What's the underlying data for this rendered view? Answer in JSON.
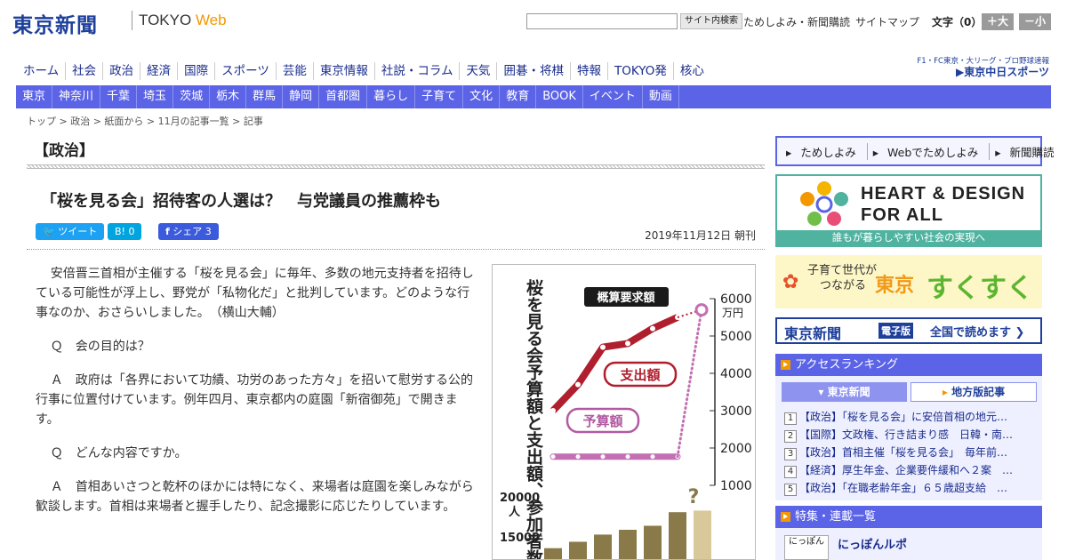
{
  "header": {
    "logo": "東京新聞",
    "logo_sub_a": "TOKYO ",
    "logo_sub_b": "Web",
    "search_button": "サイト内検索",
    "links": [
      "ためしよみ・新聞購読",
      "サイトマップ"
    ],
    "fontsize_label": "文字（0）",
    "font_up": "＋大",
    "font_down": "－小"
  },
  "nav_main": [
    "ホーム",
    "社会",
    "政治",
    "経済",
    "国際",
    "スポーツ",
    "芸能",
    "東京情報",
    "社説・コラム",
    "天気",
    "囲碁・将棋",
    "特報",
    "TOKYO発",
    "核心"
  ],
  "chunichi": {
    "line1": "F1・FC東京・大リーグ・プロ野球速報",
    "line2": "▶東京中日スポーツ"
  },
  "nav_region": [
    "東京",
    "神奈川",
    "千葉",
    "埼玉",
    "茨城",
    "栃木",
    "群馬",
    "静岡",
    "首都圏",
    "暮らし",
    "子育て",
    "文化",
    "教育",
    "BOOK",
    "イベント",
    "動画"
  ],
  "breadcrumb": "トップ > 政治 > 紙面から > 11月の記事一覧 > 記事",
  "section": "【政治】",
  "article": {
    "headline": "「桜を見る会」招待客の人選は？　与党議員の推薦枠も",
    "tweet": "ツイート",
    "hatena": "B! 0",
    "share": "シェア 3",
    "date": "2019年11月12日 朝刊",
    "paragraphs": [
      "安倍晋三首相が主催する「桜を見る会」に毎年、多数の地元支持者を招待している可能性が浮上し、野党が「私物化だ」と批判しています。どのような行事なのか、おさらいしました。　（横山大輔）",
      "Ｑ　会の目的は？",
      "Ａ　政府は「各界において功績、功労のあった方々」を招いて慰労する公的行事に位置付けています。例年四月、東京都内の庭園「新宿御苑」で開きます。",
      "Ｑ　どんな内容ですか。",
      "Ａ　首相あいさつと乾杯のほかには特になく、来場者は庭園を楽しみながら歓談します。首相は来場者と握手したり、記念撮影に応じたりしています。"
    ]
  },
  "figure": {
    "title": "桜を見る会予算額と支出額、参加者数",
    "label_request": "概算要求額",
    "label_spend": "支出額",
    "label_budget": "予算額",
    "y_ticks": [
      "6000",
      "5000",
      "4000",
      "3000",
      "2000",
      "1000"
    ],
    "y_unit": "万円",
    "count_ticks": [
      "20000",
      "15000"
    ],
    "count_unit": "人",
    "question": "?"
  },
  "chart_data": {
    "type": "line",
    "title": "桜を見る会予算額と支出額、参加者数",
    "ylabel": "万円",
    "ylim": [
      1000,
      6000
    ],
    "series": [
      {
        "name": "支出額",
        "values": [
          3000,
          3700,
          4700,
          4800,
          5200,
          5500
        ]
      },
      {
        "name": "予算額",
        "values": [
          1767,
          1767,
          1767,
          1767,
          1767,
          1767
        ]
      },
      {
        "name": "概算要求額",
        "values": [
          5700
        ]
      }
    ],
    "participants": {
      "unit": "人",
      "ticks": [
        20000,
        15000
      ],
      "values": [
        13700,
        14500,
        15400,
        16000,
        16500,
        18200,
        18400
      ]
    }
  },
  "sidebar": {
    "mini_links": [
      "ためしよみ",
      "Webでためしよみ",
      "新聞購読"
    ],
    "heart_title_1": "HEART & DESIGN",
    "heart_title_2": "FOR ALL",
    "heart_caption": "誰もが暮らしやすい社会の実現へ",
    "suku_a_1": "子育て世代が",
    "suku_a_2": "つながる",
    "suku_b": "東京",
    "suku_c": "すくすく",
    "epaper_logo": "東京新聞",
    "epaper_tag": "電子版",
    "epaper_text": "全国で読めます ❯",
    "ranking_title": "アクセスランキング",
    "ranking_tab1": "東京新聞",
    "ranking_tab2": "地方版記事",
    "ranking": [
      "【政治】「桜を見る会」に安倍首相の地元…",
      "【国際】文政権、行き詰まり感　日韓・南…",
      "【政治】首相主催「桜を見る会」　毎年前…",
      "【経済】厚生年金、企業要件緩和へ２案　…",
      "【政治】「在職老齢年金」６５歳超支給　…"
    ],
    "special_title": "特集・連載一覧",
    "nippon_box": "にっぽん",
    "nippon_title": "にっぽんルポ"
  }
}
